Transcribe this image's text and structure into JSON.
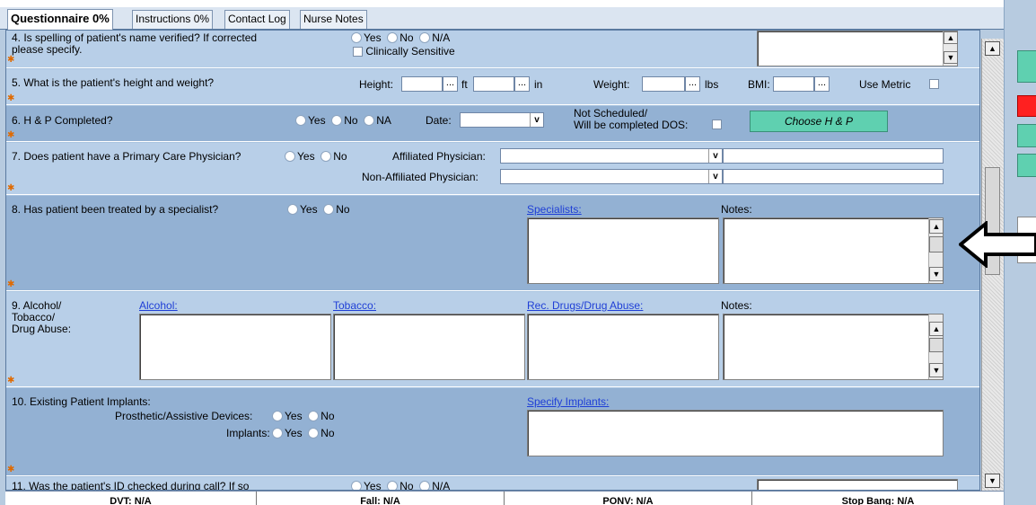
{
  "tabs": [
    "Questionnaire 0%",
    "Instructions 0%",
    "Contact Log",
    "Nurse Notes"
  ],
  "colors": {
    "accent_green": "#5fd0b0",
    "red_button": "#ff2020",
    "required_star": "#e06a00",
    "link": "#1f3fd6"
  },
  "q4": {
    "text_line1": "4. Is spelling of patient's name verified? If corrected",
    "text_line2": "please specify.",
    "opt_yes": "Yes",
    "opt_no": "No",
    "opt_na": "N/A",
    "clinically_sensitive": "Clinically Sensitive"
  },
  "q5": {
    "text": "5. What is the patient's height and weight?",
    "height_label": "Height:",
    "ft": "ft",
    "in": "in",
    "weight_label": "Weight:",
    "lbs": "lbs",
    "bmi_label": "BMI:",
    "use_metric": "Use Metric",
    "dots": "..."
  },
  "q6": {
    "text": "6. H & P Completed?",
    "opt_yes": "Yes",
    "opt_no": "No",
    "opt_na": "NA",
    "date_label": "Date:",
    "not_scheduled_1": "Not Scheduled/",
    "not_scheduled_2": "Will be completed DOS:",
    "choose_button": "Choose H & P"
  },
  "q7": {
    "text": "7. Does patient have a Primary Care Physician?",
    "opt_yes": "Yes",
    "opt_no": "No",
    "affiliated": "Affiliated Physician:",
    "non_affiliated": "Non-Affiliated Physician:"
  },
  "q8": {
    "text": "8. Has patient been treated by a specialist?",
    "opt_yes": "Yes",
    "opt_no": "No",
    "specialists_link": "Specialists:",
    "notes_label": "Notes:"
  },
  "q9": {
    "text_line1": "9. Alcohol/",
    "text_line2": "Tobacco/",
    "text_line3": "Drug Abuse:",
    "alcohol_link": "Alcohol:",
    "tobacco_link": "Tobacco:",
    "drugs_link": "Rec. Drugs/Drug Abuse:",
    "notes_label": "Notes:"
  },
  "q10": {
    "text": "10. Existing Patient Implants:",
    "prosthetic": "Prosthetic/Assistive Devices:",
    "implants": "Implants:",
    "opt_yes": "Yes",
    "opt_no": "No",
    "specify_link": "Specify Implants:"
  },
  "q11": {
    "text": "11. Was the patient's ID checked during call? If so",
    "opt_yes": "Yes",
    "opt_no": "No",
    "opt_na": "N/A"
  },
  "footer": [
    "DVT: N/A",
    "Fall: N/A",
    "PONV: N/A",
    "Stop Bang: N/A"
  ],
  "arrow_icon": "left-arrow-icon"
}
